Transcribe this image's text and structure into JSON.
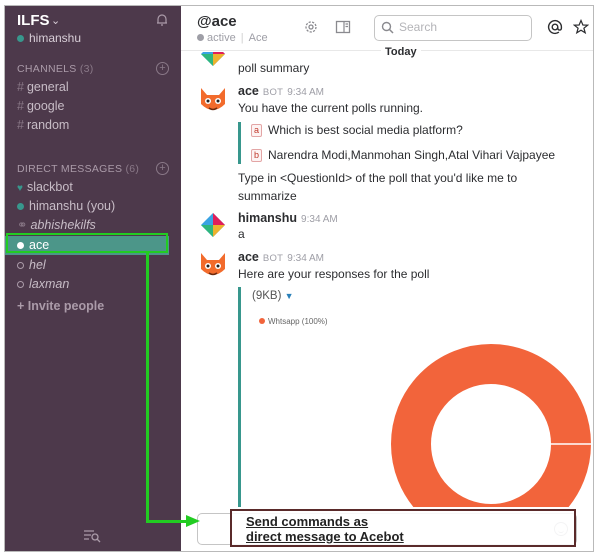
{
  "team": {
    "name": "ILFS",
    "user": "himanshu"
  },
  "sidebar": {
    "channels_label": "CHANNELS",
    "channels_count": "(3)",
    "channels": [
      "general",
      "google",
      "random"
    ],
    "dm_label": "DIRECT MESSAGES",
    "dm_count": "(6)",
    "dms": [
      {
        "name": "slackbot"
      },
      {
        "name": "himanshu (you)"
      },
      {
        "name": "abhishekilfs"
      },
      {
        "name": "ace"
      },
      {
        "name": "hel"
      },
      {
        "name": "laxman"
      }
    ],
    "invite": "+ Invite people"
  },
  "header": {
    "title": "@ace",
    "status": "active",
    "subtitle": "Ace",
    "search_placeholder": "Search",
    "day_divider": "Today"
  },
  "messages": {
    "m0_text": "poll summary",
    "m1": {
      "name": "ace",
      "tag": "BOT",
      "time": "9:34 AM",
      "text": "You have the current polls running.",
      "opts": [
        {
          "letter": "a",
          "text": "Which is best social media platform?"
        },
        {
          "letter": "b",
          "text": "Narendra Modi,Manmohan Singh,Atal Vihari Vajpayee"
        }
      ],
      "text2_line1": "Type in <QuestionId> of the poll that you'd like me to",
      "text2_line2": "summarize"
    },
    "m2": {
      "name": "himanshu",
      "time": "9:34 AM",
      "text": "a"
    },
    "m3": {
      "name": "ace",
      "tag": "BOT",
      "time": "9:34 AM",
      "text": "Here are your responses for the poll",
      "file_size": "(9KB)"
    }
  },
  "chart_data": {
    "type": "pie",
    "categories": [
      "Whtsapp"
    ],
    "values": [
      100
    ],
    "legend": "Whtsapp (100%)",
    "donut": true,
    "colors": [
      "#f2643b"
    ]
  },
  "annotation": {
    "line1": "Send commands as",
    "line2": "direct message to Acebot"
  },
  "colors": {
    "sidebar": "#4d394b",
    "active": "#4c9689",
    "accent": "#38978d",
    "highlight": "#22cc22"
  }
}
